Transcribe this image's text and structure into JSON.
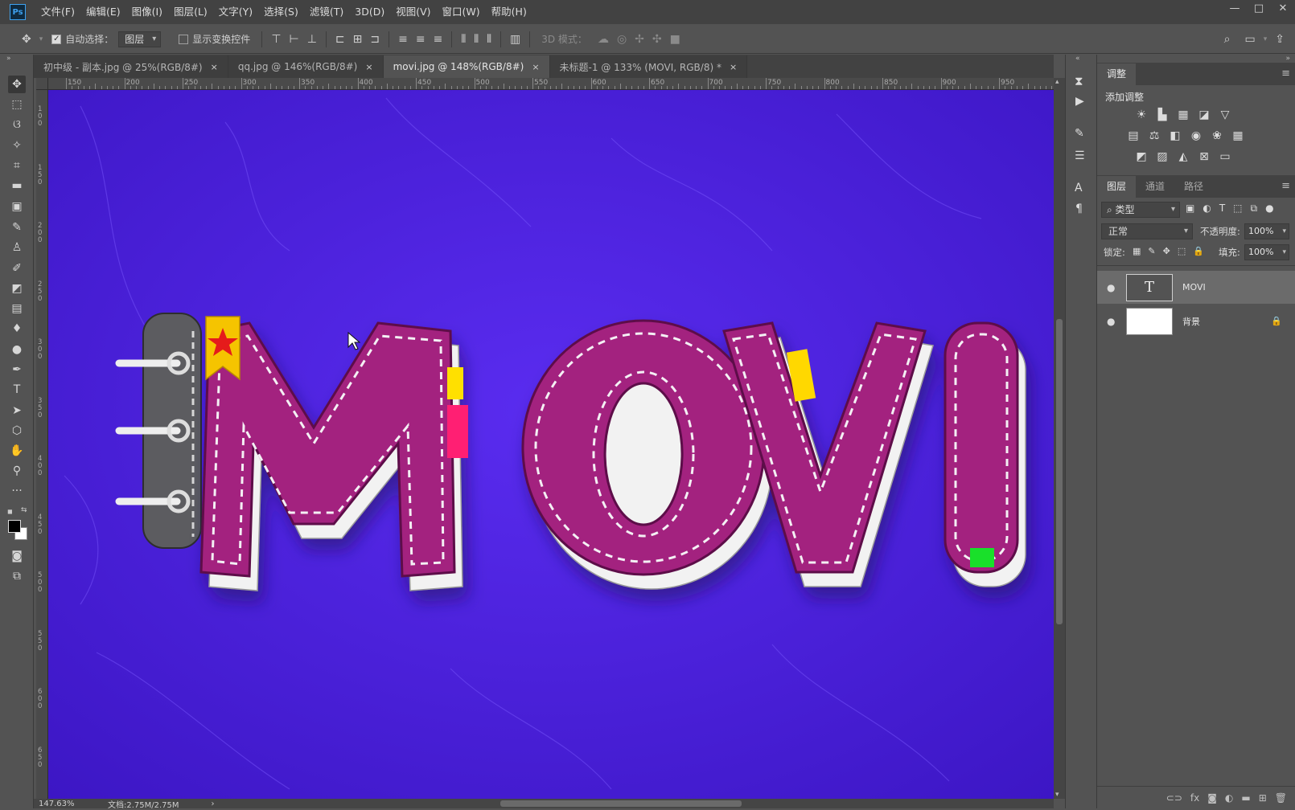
{
  "app": {
    "logo": "Ps"
  },
  "menubar": {
    "items": [
      "文件(F)",
      "编辑(E)",
      "图像(I)",
      "图层(L)",
      "文字(Y)",
      "选择(S)",
      "滤镜(T)",
      "3D(D)",
      "视图(V)",
      "窗口(W)",
      "帮助(H)"
    ]
  },
  "window_controls": {
    "minimize": "—",
    "restore": "□",
    "close": "✕"
  },
  "options": {
    "auto_select_label": "自动选择：",
    "auto_select_checked": true,
    "auto_select_target": "图层",
    "show_transform_label": "显示变换控件",
    "show_transform_checked": false,
    "mode_3d_label": "3D 模式："
  },
  "tabs": [
    {
      "label": "初中级 - 副本.jpg @ 25%(RGB/8#)",
      "active": false
    },
    {
      "label": "qq.jpg @ 146%(RGB/8#)",
      "active": false
    },
    {
      "label": "movi.jpg @ 148%(RGB/8#)",
      "active": true
    },
    {
      "label": "未标题-1 @ 133% (MOVI, RGB/8) *",
      "active": false
    }
  ],
  "tab_close": "×",
  "ruler_top_labels": [
    "150",
    "200",
    "250",
    "300",
    "350",
    "400",
    "450",
    "500",
    "550",
    "600",
    "650",
    "700",
    "750",
    "800",
    "850",
    "900",
    "950"
  ],
  "ruler_left_labels": [
    "100",
    "150",
    "200",
    "250",
    "300",
    "350",
    "400",
    "450",
    "500",
    "550",
    "600",
    "650"
  ],
  "canvas": {
    "text": "MOVI",
    "bg_color": "#4b1fe0",
    "letter_color": "#a3207f",
    "stitch_color": "#f4f0f4"
  },
  "status": {
    "zoom": "147.63%",
    "doc": "文档:2.75M/2.75M",
    "arrow": "›"
  },
  "panel_adjust": {
    "tab": "调整",
    "add_adjust_label": "添加调整"
  },
  "panel_layers": {
    "tabs": [
      "图层",
      "通道",
      "路径"
    ],
    "filter_kind": "类型",
    "blend_mode": "正常",
    "opacity_label": "不透明度:",
    "opacity_value": "100%",
    "lock_label": "锁定:",
    "fill_label": "填充:",
    "fill_value": "100%",
    "layers": [
      {
        "name": "MOVI",
        "type": "text",
        "thumb_glyph": "T",
        "selected": true,
        "locked": false
      },
      {
        "name": "背景",
        "type": "background",
        "thumb_glyph": "",
        "selected": false,
        "locked": true
      }
    ]
  }
}
